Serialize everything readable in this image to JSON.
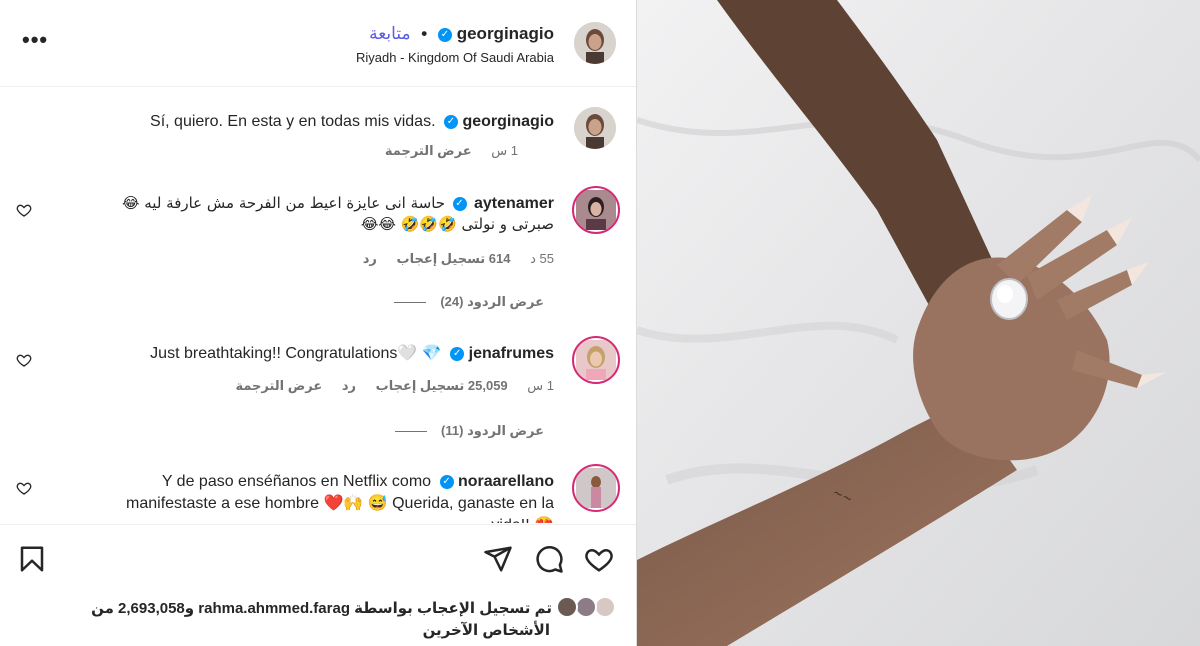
{
  "header": {
    "username": "georginagio",
    "follow_label": "متابعة",
    "separator": "•",
    "location": "Riyadh - Kingdom Of Saudi Arabia",
    "more_icon": "more-horizontal-icon"
  },
  "caption": {
    "username": "georginagio",
    "text": "Sí, quiero. En esta y en todas mis vidas.",
    "time": "1 س",
    "translate_label": "عرض الترجمة"
  },
  "comments": [
    {
      "username": "aytenamer",
      "text_line1": "حاسة انى عايزة اعيط من الفرحة مش عارفة ليه 😂",
      "text_line2": "صبرتى و نولتى 🤣🤣🤣 😂😂",
      "time": "55 د",
      "likes": "614 تسجيل إعجاب",
      "reply_label": "رد",
      "view_replies": "عرض الردود (24)"
    },
    {
      "username": "jenafrumes",
      "text": "Just breathtaking!! Congratulations🤍 💎",
      "time": "1 س",
      "likes": "25,059 تسجيل إعجاب",
      "reply_label": "رد",
      "translate_label": "عرض الترجمة",
      "view_replies": "عرض الردود (11)"
    },
    {
      "username": "noraarellano",
      "text_line1": "Y de paso enséñanos en Netflix como",
      "text_line2": "manifestaste a ese hombre ❤️🙌 😅 Querida, ganaste en la",
      "text_line3": "vida!! 😍"
    }
  ],
  "footer": {
    "likes_text": "تم تسجيل الإعجاب بواسطة rahma.ahmmed.farag و2,693,058 من",
    "likes_text2": "الأشخاص الآخرين",
    "icons": [
      "heart-icon",
      "comment-icon",
      "share-icon",
      "bookmark-icon"
    ]
  },
  "colors": {
    "verified": "#0095f6",
    "follow": "#5b5ce5",
    "muted": "#737373",
    "story_ring": "#d62976"
  }
}
